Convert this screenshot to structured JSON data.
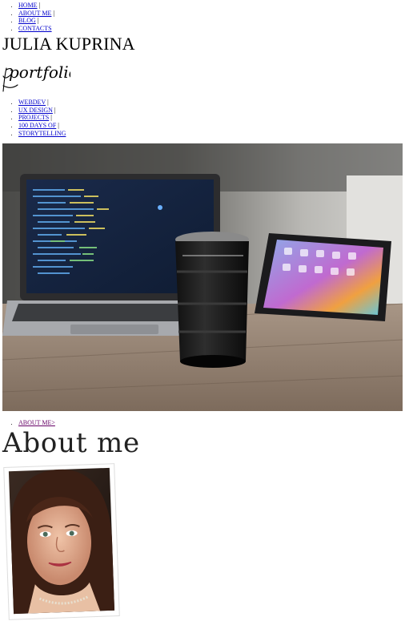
{
  "top_nav": {
    "items": [
      {
        "label": "HOME",
        "sep": " |"
      },
      {
        "label": "ABOUT ME",
        "sep": " |"
      },
      {
        "label": "BLOG",
        "sep": " |"
      },
      {
        "label": "CONTACTS",
        "sep": ""
      }
    ]
  },
  "site": {
    "title": "JULIA KUPRINA",
    "logo_text": "portfolio"
  },
  "category_nav": {
    "items": [
      {
        "label": "WEBDEV",
        "sep": " |"
      },
      {
        "label": "UX DESIGN",
        "sep": " |"
      },
      {
        "label": "PROJECTS",
        "sep": " |"
      },
      {
        "label": "100 DAYS OF",
        "sep": " |"
      },
      {
        "label": "STORYTELLING",
        "sep": ""
      }
    ]
  },
  "breadcrumb": {
    "label": "ABOUT ME>"
  },
  "page": {
    "heading": "About me"
  },
  "colors": {
    "link": "#0000cc",
    "visited_link": "#660066"
  }
}
